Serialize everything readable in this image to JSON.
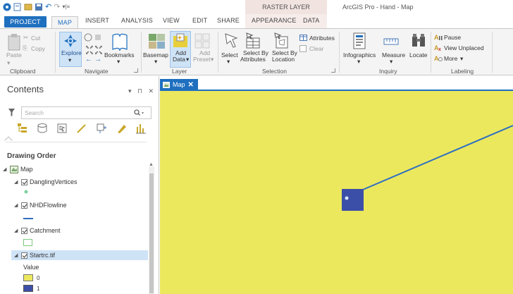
{
  "titlebar": {
    "context_title": "RASTER LAYER",
    "app_title": "ArcGIS Pro - Hand - Map"
  },
  "tabs": [
    "PROJECT",
    "MAP",
    "INSERT",
    "ANALYSIS",
    "VIEW",
    "EDIT",
    "SHARE",
    "APPEARANCE",
    "DATA"
  ],
  "ribbon": {
    "clipboard": {
      "paste": "Paste",
      "cut": "Cut",
      "copy": "Copy",
      "group_label": "Clipboard"
    },
    "navigate": {
      "explore": "Explore",
      "bookmarks": "Bookmarks",
      "group_label": "Navigate"
    },
    "layer": {
      "basemap": "Basemap",
      "add_data_1": "Add",
      "add_data_2": "Data",
      "add_preset_1": "Add",
      "add_preset_2": "Preset",
      "group_label": "Layer"
    },
    "selection": {
      "select": "Select",
      "select_by_attributes_1": "Select By",
      "select_by_attributes_2": "Attributes",
      "select_by_location_1": "Select By",
      "select_by_location_2": "Location",
      "attributes": "Attributes",
      "clear": "Clear",
      "group_label": "Selection"
    },
    "inquiry": {
      "infographics": "Infographics",
      "measure": "Measure",
      "locate": "Locate",
      "group_label": "Inquiry"
    },
    "labeling": {
      "pause": "Pause",
      "view_unplaced": "View Unplaced",
      "more": "More",
      "group_label": "Labeling"
    }
  },
  "contents": {
    "title": "Contents",
    "controls": "▾ ⊓ ✕",
    "search_placeholder": "Search",
    "drawing_order": "Drawing Order",
    "layers": [
      {
        "name": "Map"
      },
      {
        "name": "DanglingVertices"
      },
      {
        "name": "NHDFlowline"
      },
      {
        "name": "Catchment"
      },
      {
        "name": "Startrc.tif"
      }
    ],
    "value_label": "Value",
    "legend": [
      {
        "label": "0",
        "color": "#ebe85e"
      },
      {
        "label": "1",
        "color": "#3c4fa8"
      }
    ]
  },
  "map_view": {
    "tab_label": "Map",
    "close": "✕",
    "colors": {
      "background": "#ebe85e",
      "cell": "#3c4fa8",
      "flowline": "#2e6fc0",
      "vertex": "#7fd3a0"
    }
  }
}
